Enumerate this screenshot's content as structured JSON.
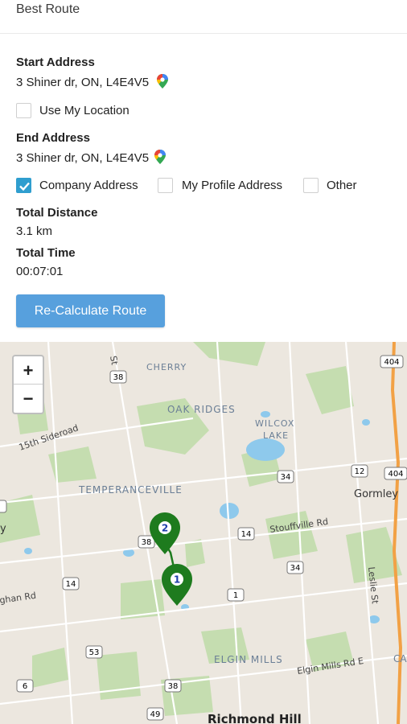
{
  "header": {
    "title": "Best Route"
  },
  "start": {
    "label": "Start Address",
    "value": "3 Shiner dr, ON, L4E4V5"
  },
  "use_location": {
    "label": "Use My Location",
    "checked": false
  },
  "end": {
    "label": "End Address",
    "value": "3 Shiner dr, ON, L4E4V5"
  },
  "end_options": [
    {
      "label": "Company Address",
      "checked": true
    },
    {
      "label": "My Profile Address",
      "checked": false
    },
    {
      "label": "Other",
      "checked": false
    }
  ],
  "distance": {
    "label": "Total Distance",
    "value": "3.1 km"
  },
  "time": {
    "label": "Total Time",
    "value": "00:07:01"
  },
  "recalc_button": "Re-Calculate Route",
  "map": {
    "zoom_in": "+",
    "zoom_out": "−",
    "place_labels": [
      "CHERRY",
      "OAK RIDGES",
      "WILCOX",
      "LAKE",
      "TEMPERANCEVILLE",
      "ELGIN MILLS",
      "Gormley",
      "Richmond Hill",
      "15th Sideroad",
      "Stouffville Rd",
      "Elgin Mills Rd E",
      "Leslie St",
      "ghan Rd",
      "St",
      "CA",
      "y"
    ],
    "road_shields": [
      "38",
      "34",
      "12",
      "404",
      "404",
      "14",
      "34",
      "38",
      "1",
      "14",
      "53",
      "6",
      "38",
      "49"
    ],
    "markers": [
      "2",
      "1"
    ],
    "marker_color": "#1e7b1e"
  }
}
